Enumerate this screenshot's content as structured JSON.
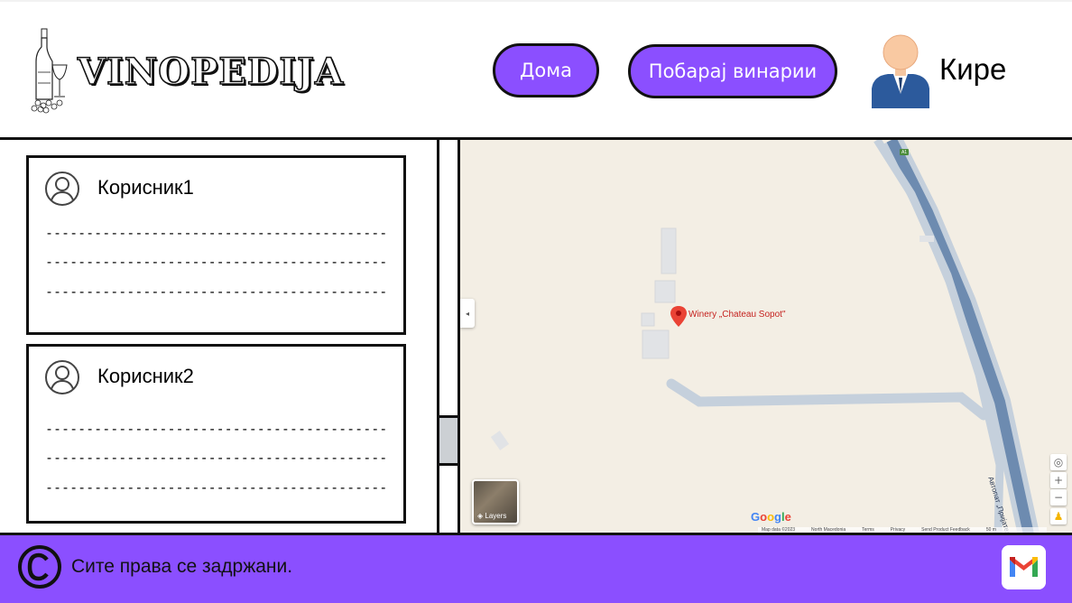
{
  "brand": {
    "name": "VINOPEDIJA"
  },
  "nav": {
    "home_label": "Дома",
    "search_label": "Побарај винарии"
  },
  "user": {
    "name": "Кире"
  },
  "comments": [
    {
      "author": "Корисник1",
      "lines": [
        "---------------------------------------------",
        "---------------------------------------------",
        "---------------------------------------------"
      ]
    },
    {
      "author": "Корисник2",
      "lines": [
        "---------------------------------------------",
        "---------------------------------------------",
        "---------------------------------------------"
      ]
    }
  ],
  "map": {
    "marker_label": "Winery „Chateau Sopot\"",
    "layers_label": "Layers",
    "google_label": "Google",
    "road_label": "Автопат „Пријателство",
    "road_badge": "A1",
    "footer_items": [
      "Map data ©2023",
      "North Macedonia",
      "Terms",
      "Privacy",
      "Send Product Feedback",
      "50 m"
    ]
  },
  "footer": {
    "copyright_text": "Сите права се задржани."
  },
  "colors": {
    "accent": "#8b4fff",
    "map_bg": "#f3eee4",
    "marker": "#ea4335"
  }
}
